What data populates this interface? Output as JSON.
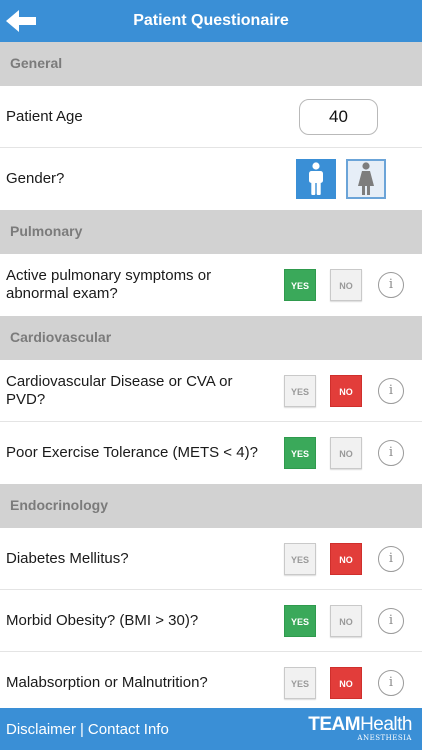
{
  "header": {
    "title": "Patient Questionaire"
  },
  "sections": {
    "general": {
      "title": "General",
      "age_label": "Patient Age",
      "age_value": "40",
      "gender_label": "Gender?",
      "gender_selected": "male"
    },
    "pulmonary": {
      "title": "Pulmonary",
      "items": [
        {
          "label": "Active pulmonary symptoms or abnormal exam?",
          "answer": "yes"
        }
      ]
    },
    "cardiovascular": {
      "title": "Cardiovascular",
      "items": [
        {
          "label": "Cardiovascular Disease or CVA or PVD?",
          "answer": "no"
        },
        {
          "label": "Poor Exercise Tolerance (METS < 4)?",
          "answer": "yes"
        }
      ]
    },
    "endocrinology": {
      "title": "Endocrinology",
      "items": [
        {
          "label": "Diabetes Mellitus?",
          "answer": "no"
        },
        {
          "label": "Morbid Obesity? (BMI > 30)?",
          "answer": "yes"
        },
        {
          "label": "Malabsorption or Malnutrition?",
          "answer": "no"
        }
      ]
    }
  },
  "buttons": {
    "yes": "YES",
    "no": "NO",
    "info": "i"
  },
  "footer": {
    "disclaimer": "Disclaimer",
    "separator": "|",
    "contact": "Contact Info",
    "logo_team": "TEAM",
    "logo_health": "Health",
    "logo_sub": "ANESTHESIA"
  },
  "colors": {
    "accent": "#3a8fd6",
    "yes_active": "#3aa95a",
    "no_active": "#e23d3a",
    "section_bg": "#d2d2d2"
  },
  "icons": [
    "back-arrow-icon",
    "male-icon",
    "female-icon",
    "info-icon"
  ]
}
